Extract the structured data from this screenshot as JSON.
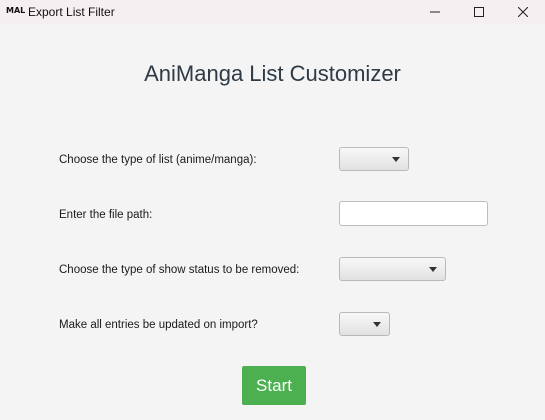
{
  "window": {
    "icon_text": "MAL",
    "title": "Export List Filter"
  },
  "app_title": "AniManga List Customizer",
  "form": {
    "list_type_label": "Choose the type of list (anime/manga):",
    "list_type_value": "",
    "file_path_label": "Enter the file path:",
    "file_path_value": "",
    "status_label": "Choose the type of show status to be removed:",
    "status_value": "",
    "update_label": "Make all entries be updated on import?",
    "update_value": ""
  },
  "start_button": {
    "label": "Start",
    "color": "#4caf50"
  },
  "icons": {
    "minimize": "minimize-icon",
    "maximize": "maximize-icon",
    "close": "close-icon",
    "dropdown": "chevron-down-icon"
  }
}
